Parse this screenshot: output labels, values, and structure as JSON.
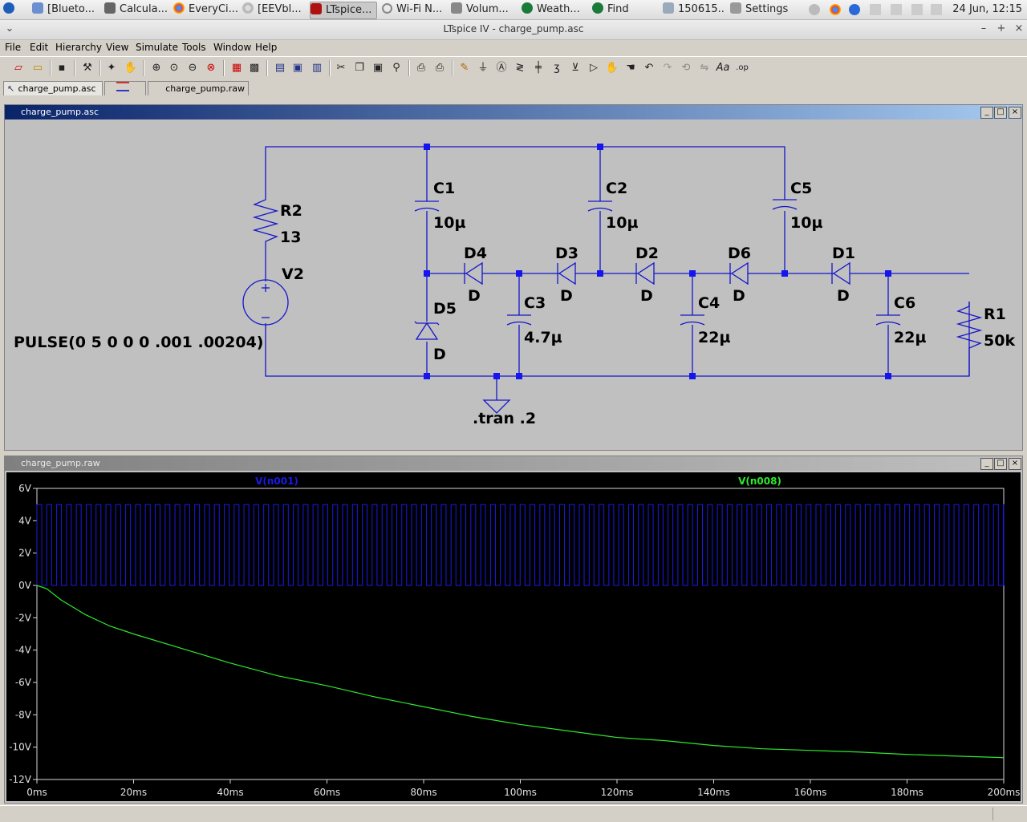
{
  "taskbar": {
    "tasks": [
      {
        "label": "[Blueto..."
      },
      {
        "label": "Calcula..."
      },
      {
        "label": "EveryCi..."
      },
      {
        "label": "[EEVbl..."
      },
      {
        "label": "LTspice..."
      },
      {
        "label": "Wi-Fi N..."
      },
      {
        "label": "Volum..."
      },
      {
        "label": "Weath..."
      },
      {
        "label": "Find"
      },
      {
        "label": "150615..."
      },
      {
        "label": "Settings"
      }
    ],
    "clock": "24 Jun, 12:15"
  },
  "window": {
    "title": "LTspice IV - charge_pump.asc"
  },
  "menu": {
    "items": [
      "File",
      "Edit",
      "Hierarchy",
      "View",
      "Simulate",
      "Tools",
      "Window",
      "Help"
    ]
  },
  "doc_tabs": [
    {
      "label": "charge_pump.asc"
    },
    {
      "label": ""
    },
    {
      "label": "charge_pump.raw"
    }
  ],
  "schematic": {
    "window_title": "charge_pump.asc",
    "components": {
      "c1_name": "C1",
      "c1_value": "10µ",
      "c2_name": "C2",
      "c2_value": "10µ",
      "c5_name": "C5",
      "c5_value": "10µ",
      "r2_name": "R2",
      "r2_value": "13",
      "v2_name": "V2",
      "pulse": "PULSE(0 5 0 0 0 .001 .00204)",
      "d4_name": "D4",
      "d4_model": "D",
      "d3_name": "D3",
      "d3_model": "D",
      "d2_name": "D2",
      "d2_model": "D",
      "d6_name": "D6",
      "d6_model": "D",
      "d1_name": "D1",
      "d1_model": "D",
      "d5_name": "D5",
      "d5_model": "D",
      "c3_name": "C3",
      "c3_value": "4.7µ",
      "c4_name": "C4",
      "c4_value": "22µ",
      "c6_name": "C6",
      "c6_value": "22µ",
      "r1_name": "R1",
      "r1_value": "50k",
      "directive": ".tran .2"
    }
  },
  "waveform": {
    "window_title": "charge_pump.raw",
    "colors": {
      "v001": "#1a1ae6",
      "v008": "#2ee82e"
    }
  },
  "chart_data": {
    "type": "line",
    "xlabel": "",
    "ylabel": "",
    "xlim": [
      0,
      200
    ],
    "ylim": [
      -12,
      6
    ],
    "x_ticks": [
      "0ms",
      "20ms",
      "40ms",
      "60ms",
      "80ms",
      "100ms",
      "120ms",
      "140ms",
      "160ms",
      "180ms",
      "200ms"
    ],
    "y_ticks": [
      "6V",
      "4V",
      "2V",
      "0V",
      "-2V",
      "-4V",
      "-6V",
      "-8V",
      "-10V",
      "-12V"
    ],
    "series": [
      {
        "name": "V(n001)",
        "kind": "square",
        "low": 0,
        "high": 5,
        "period_ms": 2.04,
        "pulse_width_ms": 1.0,
        "start_ms": 0,
        "end_ms": 200
      },
      {
        "name": "V(n008)",
        "x": [
          0,
          2,
          5,
          10,
          15,
          20,
          30,
          40,
          50,
          60,
          70,
          80,
          90,
          100,
          110,
          120,
          130,
          140,
          150,
          160,
          170,
          180,
          190,
          200
        ],
        "y": [
          0,
          -0.2,
          -0.9,
          -1.8,
          -2.5,
          -3.0,
          -3.9,
          -4.8,
          -5.6,
          -6.2,
          -6.9,
          -7.5,
          -8.1,
          -8.6,
          -9.0,
          -9.4,
          -9.6,
          -9.9,
          -10.1,
          -10.2,
          -10.3,
          -10.45,
          -10.55,
          -10.65
        ]
      }
    ]
  }
}
